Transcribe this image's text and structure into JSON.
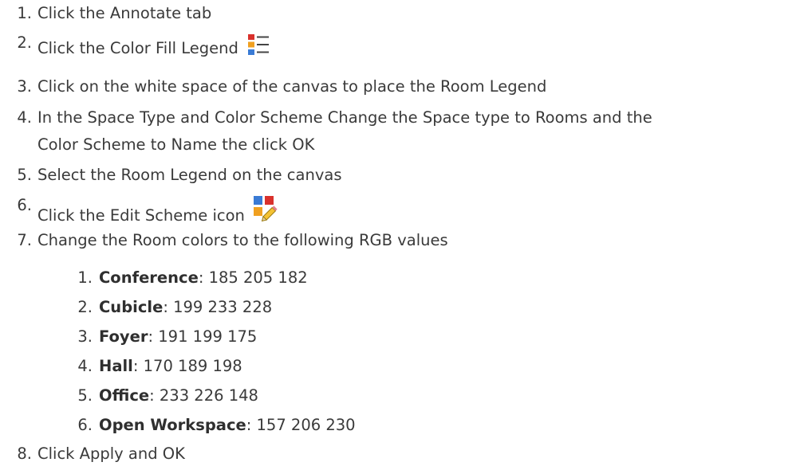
{
  "steps": [
    {
      "num": "1.",
      "text": "Click the Annotate tab"
    },
    {
      "num": "2.",
      "text": "Click the Color Fill Legend",
      "icon": "color-fill-legend-icon"
    },
    {
      "num": "3.",
      "text": "Click on the white space of the canvas to place the Room Legend"
    },
    {
      "num": "4.",
      "text": "In the Space Type and Color Scheme Change the Space type to Rooms and the",
      "text2": "Color Scheme to Name the click OK"
    },
    {
      "num": "5.",
      "text": "Select the Room Legend on the canvas"
    },
    {
      "num": "6.",
      "text": "Click the Edit Scheme icon",
      "icon": "edit-scheme-icon"
    },
    {
      "num": "7.",
      "text": "Change the Room colors to the following RGB values"
    },
    {
      "num": "8.",
      "text": "Click Apply and OK"
    }
  ],
  "rooms": [
    {
      "num": "1.",
      "name": "Conference",
      "rgb": ": 185 205 182"
    },
    {
      "num": "2.",
      "name": "Cubicle",
      "rgb": ": 199 233 228"
    },
    {
      "num": "3.",
      "name": "Foyer",
      "rgb": ": 191 199 175"
    },
    {
      "num": "4.",
      "name": "Hall",
      "rgb": ": 170 189 198"
    },
    {
      "num": "5.",
      "name": "Office",
      "rgb": ": 233 226 148"
    },
    {
      "num": "6.",
      "name": "Open Workspace",
      "rgb": ": 157 206 230"
    }
  ],
  "colors": {
    "text": "#3a3a3a",
    "icon_red": "#d9312c",
    "icon_blue": "#3a7bd5",
    "icon_orange": "#f0a020"
  }
}
